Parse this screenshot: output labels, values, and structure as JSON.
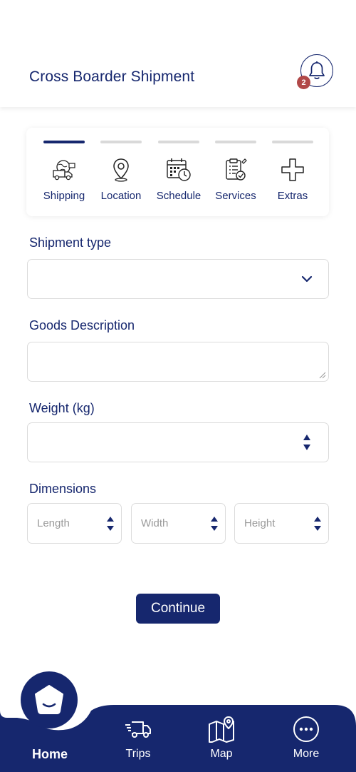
{
  "header": {
    "title": "Cross Boarder Shipment",
    "notification_count": "2"
  },
  "steps": [
    {
      "label": "Shipping",
      "icon": "shipping-icon",
      "active": true
    },
    {
      "label": "Location",
      "icon": "location-pin-icon",
      "active": false
    },
    {
      "label": "Schedule",
      "icon": "calendar-clock-icon",
      "active": false
    },
    {
      "label": "Services",
      "icon": "clipboard-check-icon",
      "active": false
    },
    {
      "label": "Extras",
      "icon": "plus-icon",
      "active": false
    }
  ],
  "form": {
    "shipment_type": {
      "label": "Shipment type",
      "value": ""
    },
    "goods_description": {
      "label": "Goods Description",
      "value": ""
    },
    "weight": {
      "label": "Weight (kg)",
      "value": ""
    },
    "dimensions": {
      "label": "Dimensions",
      "length_placeholder": "Length",
      "width_placeholder": "Width",
      "height_placeholder": "Height"
    },
    "continue_label": "Continue"
  },
  "nav": {
    "home": "Home",
    "trips": "Trips",
    "map": "Map",
    "more": "More"
  },
  "colors": {
    "primary": "#16276e",
    "badge": "#b14848",
    "inactive_bar": "#d9d9d9"
  }
}
